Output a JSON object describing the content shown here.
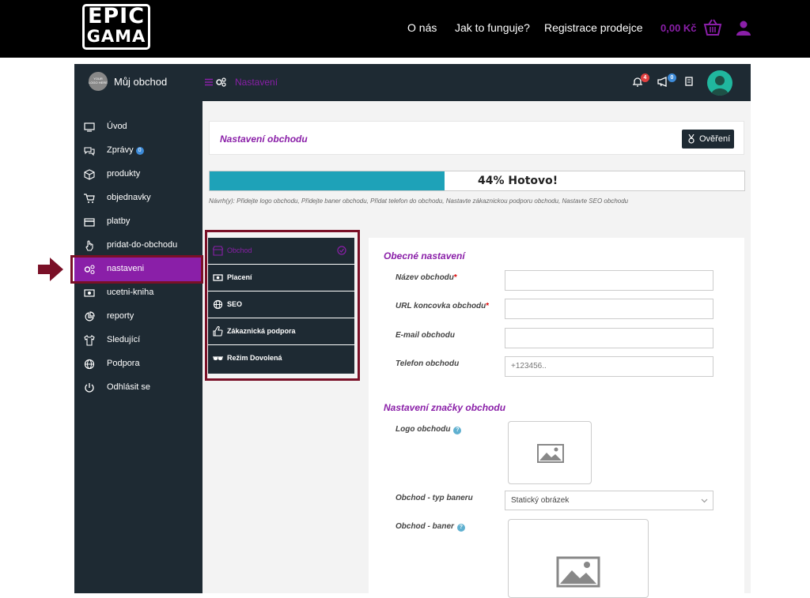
{
  "site": {
    "logo_line1": "EPIC",
    "logo_line2": "GAMA",
    "nav": [
      "O nás",
      "Jak to funguje?",
      "Registrace prodejce"
    ],
    "cart_price": "0,00 Kč"
  },
  "dashboard": {
    "shop_name": "Můj obchod",
    "shop_avatar_text": "YOUR LOGO HERE",
    "breadcrumb": "Nastavení",
    "notifications_count": "4",
    "announcements_count": "0"
  },
  "sidebar": {
    "items": [
      {
        "label": "Úvod",
        "icon": "monitor-icon"
      },
      {
        "label": "Zprávy",
        "icon": "chat-icon",
        "badge": "0"
      },
      {
        "label": "produkty",
        "icon": "box-icon"
      },
      {
        "label": "objednavky",
        "icon": "cart-icon"
      },
      {
        "label": "platby",
        "icon": "card-icon"
      },
      {
        "label": "pridat-do-obchodu",
        "icon": "hand-icon"
      },
      {
        "label": "nastaveni",
        "icon": "gears-icon",
        "active": true
      },
      {
        "label": "ucetni-kniha",
        "icon": "money-icon"
      },
      {
        "label": "reporty",
        "icon": "chart-icon"
      },
      {
        "label": "Sledující",
        "icon": "shirt-icon"
      },
      {
        "label": "Podpora",
        "icon": "globe-icon"
      },
      {
        "label": "Odhlásit se",
        "icon": "power-icon"
      }
    ]
  },
  "settings": {
    "title": "Nastavení obchodu",
    "verify_label": "Ověření",
    "progress_percent": 44,
    "progress_label": "44% Hotovo!",
    "hint": "Návrh(y): Přidejte logo obchodu, Přidejte baner obchodu, Přidat telefon do obchodu, Nastavte zákaznickou podporu obchodu, Nastavte SEO obchodu"
  },
  "tabs": [
    {
      "label": "Obchod",
      "active": true
    },
    {
      "label": "Placení"
    },
    {
      "label": "SEO"
    },
    {
      "label": "Zákaznická podpora"
    },
    {
      "label": "Režim Dovolená"
    }
  ],
  "form": {
    "general_title": "Obecné nastavení",
    "name_label": "Název obchodu",
    "url_label": "URL koncovka obchodu",
    "email_label": "E-mail obchodu",
    "phone_label": "Telefon obchodu",
    "phone_placeholder": "+123456..",
    "brand_title": "Nastavení značky obchodu",
    "logo_label": "Logo obchodu",
    "banner_type_label": "Obchod - typ baneru",
    "banner_type_value": "Statický obrázek",
    "banner_label": "Obchod - baner",
    "required_mark": "*",
    "info_mark": "?"
  },
  "colors": {
    "accent": "#8a1fa8",
    "dark": "#1e2a33",
    "progress": "#1ea2b8",
    "highlight_border": "#7a1027"
  }
}
